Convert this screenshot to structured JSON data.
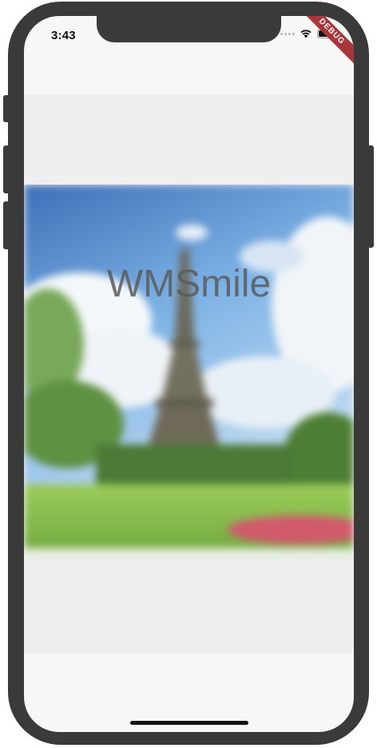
{
  "status_bar": {
    "time": "3:43",
    "debug_banner": "DEBUG",
    "icons": [
      "signal-icon",
      "wifi-icon",
      "battery-icon"
    ]
  },
  "main": {
    "title": "WMSmile",
    "image_subject": "eiffel-tower-park-photo"
  },
  "colors": {
    "frame": "#3a3a3a",
    "screen_bg": "#f7f7f7",
    "content_bg": "#efefef",
    "debug_banner": "#a8353a",
    "title_text": "#5a5a5a"
  }
}
